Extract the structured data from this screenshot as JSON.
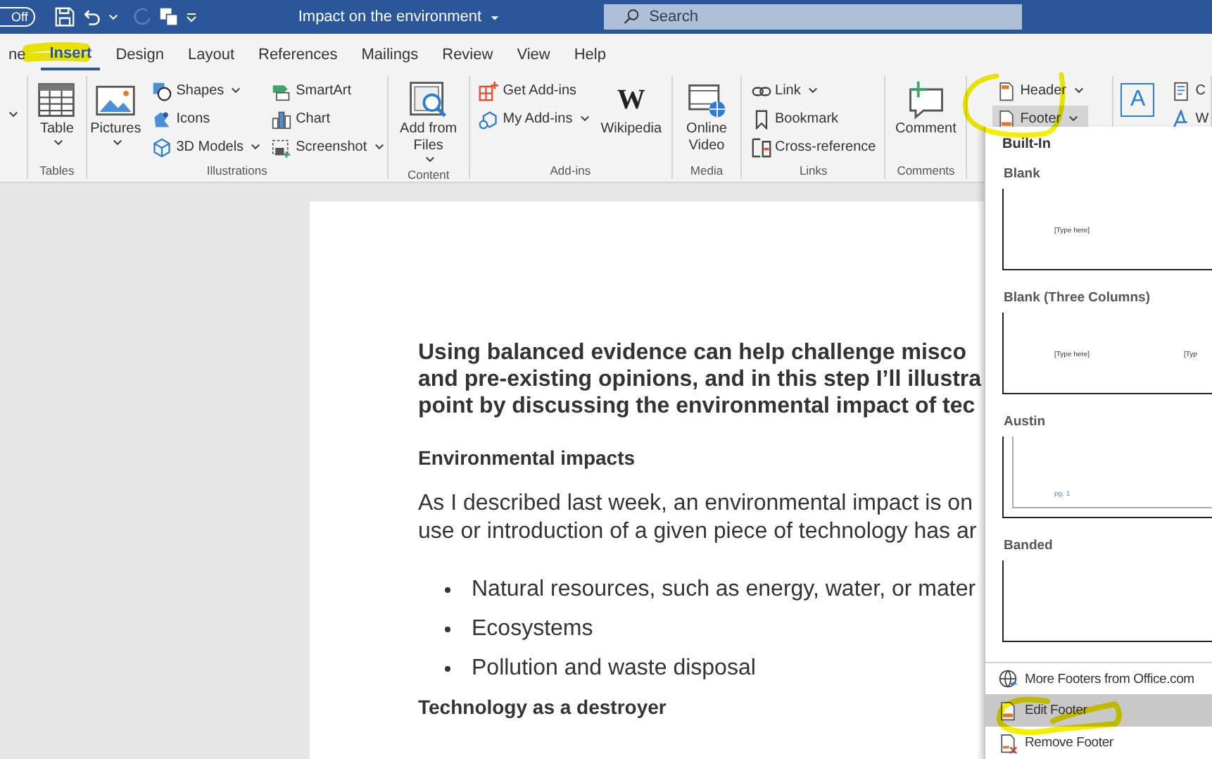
{
  "title_bar": {
    "autosave": "Off",
    "title": "Impact on the environment",
    "search_placeholder": "Search"
  },
  "tabs": [
    {
      "label": "ne",
      "selected": false
    },
    {
      "label": "Insert",
      "selected": true
    },
    {
      "label": "Design",
      "selected": false
    },
    {
      "label": "Layout",
      "selected": false
    },
    {
      "label": "References",
      "selected": false
    },
    {
      "label": "Mailings",
      "selected": false
    },
    {
      "label": "Review",
      "selected": false
    },
    {
      "label": "View",
      "selected": false
    },
    {
      "label": "Help",
      "selected": false
    }
  ],
  "ribbon": {
    "groups": [
      {
        "label": "Tables",
        "items": [
          {
            "label": "Table",
            "kind": "large",
            "dropdown": true
          }
        ]
      },
      {
        "label": "Illustrations",
        "items": [
          {
            "label": "Pictures",
            "kind": "large",
            "dropdown": true
          },
          {
            "label": "Shapes",
            "kind": "small",
            "dropdown": true
          },
          {
            "label": "Icons",
            "kind": "small",
            "dropdown": false
          },
          {
            "label": "3D Models",
            "kind": "small",
            "dropdown": true
          },
          {
            "label": "SmartArt",
            "kind": "small",
            "dropdown": false
          },
          {
            "label": "Chart",
            "kind": "small",
            "dropdown": false
          },
          {
            "label": "Screenshot",
            "kind": "small",
            "dropdown": true
          }
        ]
      },
      {
        "label": "Content",
        "items": [
          {
            "label": "Add from Files",
            "kind": "large",
            "dropdown": true
          }
        ]
      },
      {
        "label": "Add-ins",
        "items": [
          {
            "label": "Get Add-ins",
            "kind": "small",
            "dropdown": false
          },
          {
            "label": "My Add-ins",
            "kind": "small",
            "dropdown": true
          },
          {
            "label": "Wikipedia",
            "kind": "large",
            "dropdown": false,
            "logo": "W"
          }
        ]
      },
      {
        "label": "Media",
        "items": [
          {
            "label": "Online Video",
            "kind": "large",
            "dropdown": false
          }
        ]
      },
      {
        "label": "Links",
        "items": [
          {
            "label": "Link",
            "kind": "small",
            "dropdown": true
          },
          {
            "label": "Bookmark",
            "kind": "small",
            "dropdown": false
          },
          {
            "label": "Cross-reference",
            "kind": "small",
            "dropdown": false
          }
        ]
      },
      {
        "label": "Comments",
        "items": [
          {
            "label": "Comment",
            "kind": "large",
            "dropdown": false
          }
        ]
      },
      {
        "items": [
          {
            "label": "Header",
            "kind": "small",
            "dropdown": true,
            "selected": false
          },
          {
            "label": "Footer",
            "kind": "small",
            "dropdown": true,
            "selected": true
          }
        ]
      },
      {
        "items": [
          {
            "kind": "large",
            "dropdown": false,
            "logo": "A"
          },
          {
            "label": "C",
            "kind": "small",
            "dropdown": false
          },
          {
            "label": "W",
            "kind": "small",
            "dropdown": false
          }
        ]
      }
    ]
  },
  "document": {
    "blocks": [
      {
        "kind": "lead",
        "lines": [
          "Using balanced evidence can help challenge misco",
          "and pre-existing opinions, and in this step I’ll illustra",
          "point by discussing the environmental impact of tec"
        ]
      },
      {
        "kind": "heading",
        "lines": [
          "Environmental impacts"
        ]
      },
      {
        "kind": "body",
        "lines": [
          "As I described last week, an environmental impact is on",
          "use or introduction of a given piece of technology has ar"
        ]
      },
      {
        "kind": "bullet",
        "lines": [
          "Natural resources, such as energy, water, or mater"
        ]
      },
      {
        "kind": "bullet",
        "lines": [
          "Ecosystems"
        ]
      },
      {
        "kind": "bullet",
        "lines": [
          "Pollution and waste disposal"
        ]
      },
      {
        "kind": "heading",
        "lines": [
          "Technology as a destroyer"
        ]
      }
    ]
  },
  "footer_menu": {
    "heading": "Built-In",
    "gallery": [
      {
        "name": "Blank",
        "kind": "plain",
        "preview": [
          "[Type here]"
        ]
      },
      {
        "name": "Blank (Three Columns)",
        "kind": "plain",
        "preview": [
          "[Type here]",
          "[Typ"
        ]
      },
      {
        "name": "Austin",
        "kind": "framed",
        "preview": [
          "pg. 1"
        ]
      },
      {
        "name": "Banded",
        "kind": "plain"
      }
    ],
    "items": [
      {
        "label": "More Footers from Office.com",
        "selected": false
      },
      {
        "label": "Edit Footer",
        "selected": true
      },
      {
        "label": "Remove Footer",
        "selected": false
      }
    ]
  }
}
